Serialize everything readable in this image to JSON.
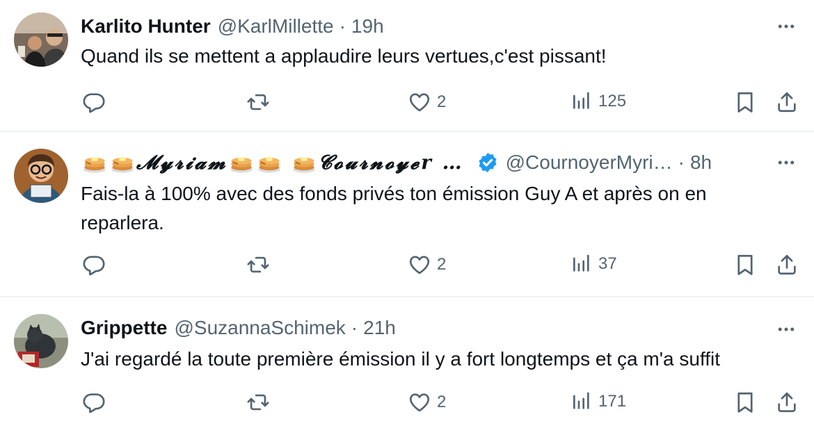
{
  "tweets": [
    {
      "name": "Karlito Hunter",
      "handle": "@KarlMillette",
      "separator": "·",
      "time": "19h",
      "text": "Quand ils se mettent a applaudire leurs vertues,c'est pissant!",
      "likes": "2",
      "views": "125",
      "verified": false
    },
    {
      "name_part1": "𝓜𝔂𝓻𝓲𝓪𝓶",
      "name_part2": "𝓒𝓸𝓾𝓻𝓷𝓸𝔂𝓮r …",
      "handle": "@CournoyerMyri…",
      "separator": "·",
      "time": "8h",
      "text": "Fais-la à 100% avec des fonds privés ton émission Guy A et après on en reparlera.",
      "likes": "2",
      "views": "37",
      "verified": true
    },
    {
      "name": "Grippette",
      "handle": "@SuzannaSchimek",
      "separator": "·",
      "time": "21h",
      "text": "J'ai regardé la toute première émission il y a fort longtemps et ça m'a suffit",
      "likes": "2",
      "views": "171",
      "verified": false
    }
  ],
  "icons": {
    "reply": "reply-icon",
    "retweet": "retweet-icon",
    "like": "heart-icon",
    "views": "views-icon",
    "bookmark": "bookmark-icon",
    "share": "share-icon",
    "more": "more-icon",
    "verified": "verified-badge-icon",
    "pancakes": "pancakes-emoji"
  },
  "colors": {
    "text": "#0f1419",
    "secondary": "#536471",
    "divider": "#eff3f4",
    "verified": "#1d9bf0"
  }
}
